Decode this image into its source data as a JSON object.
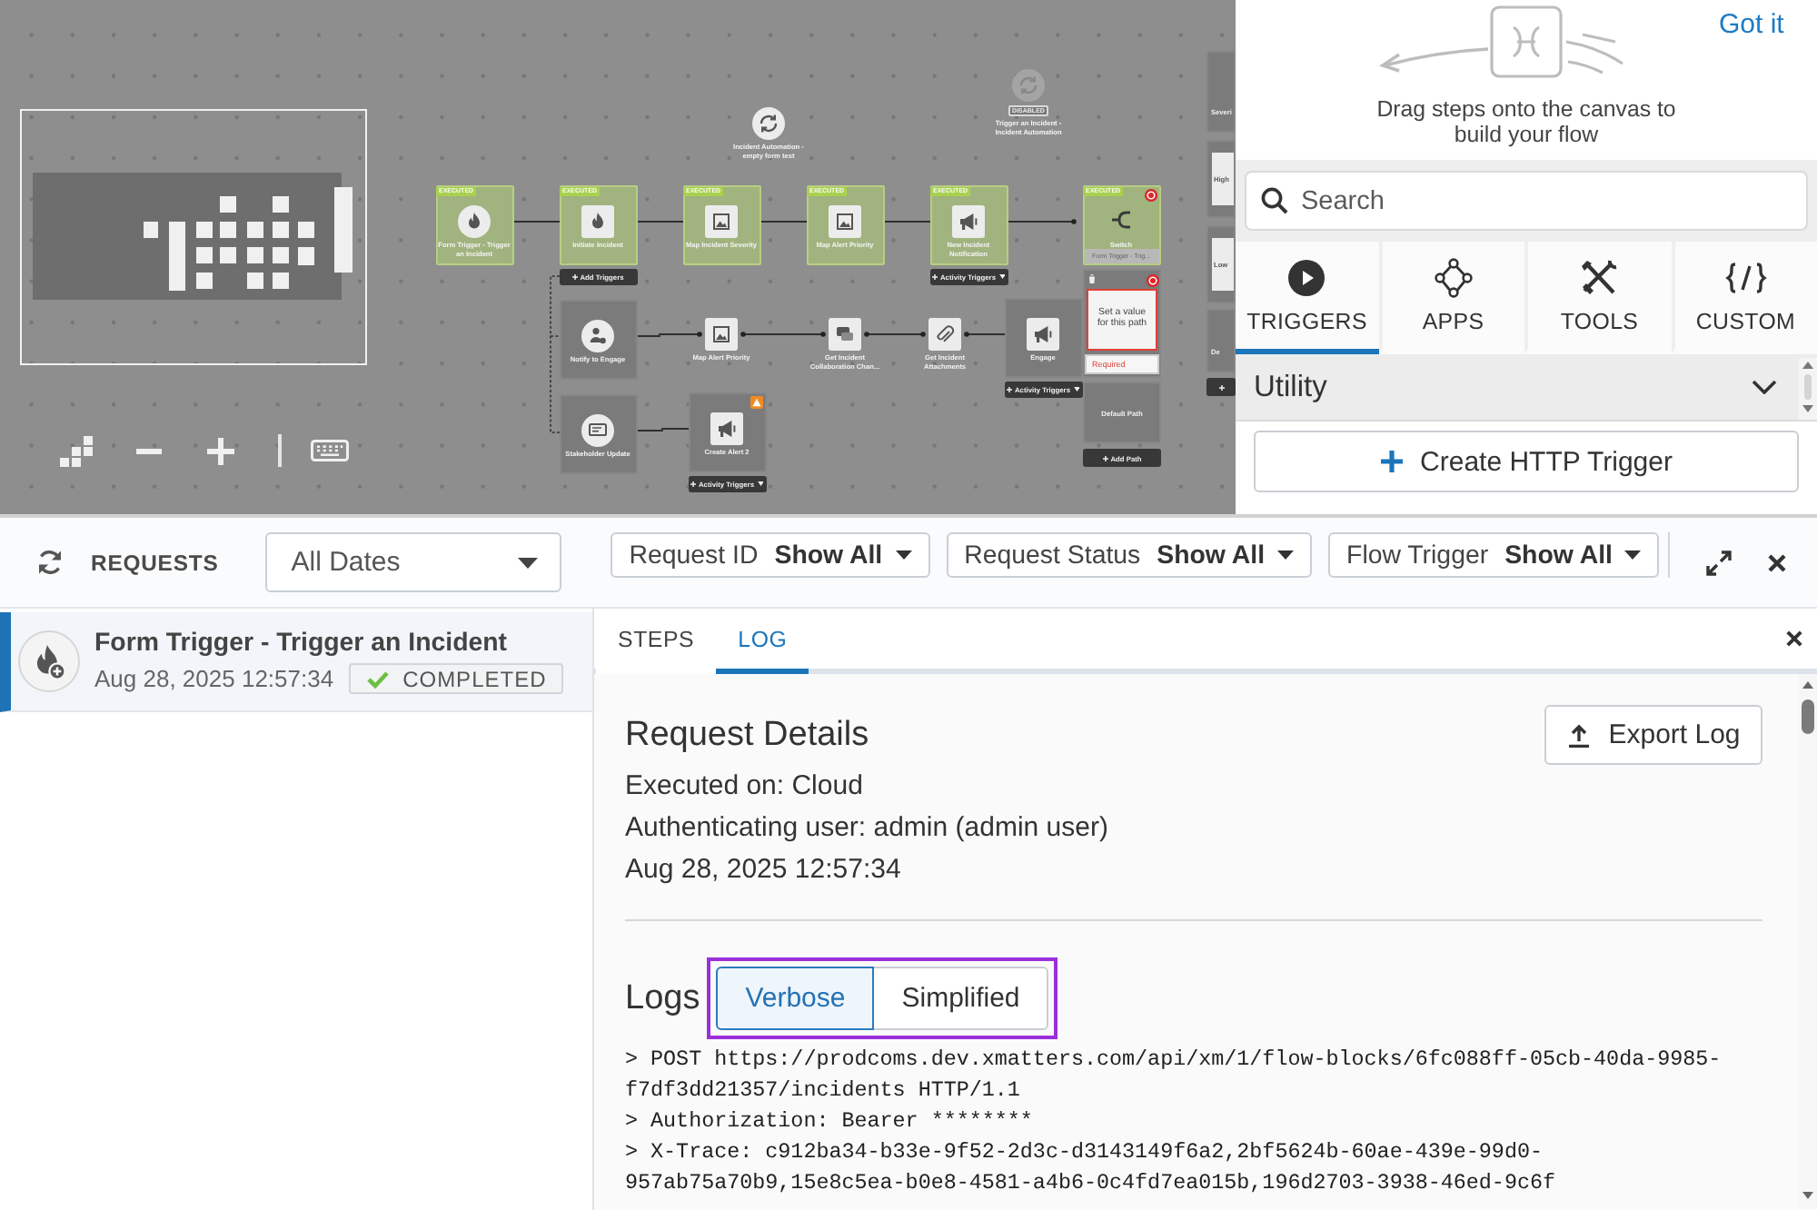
{
  "canvas": {
    "flows": [
      {
        "label": "Incident Automation - empty form test",
        "disabled": false
      },
      {
        "label": "Trigger an Incident - Incident Automation",
        "disabled": true,
        "badge": "DISABLED"
      }
    ],
    "steps": [
      {
        "kind": "trigger",
        "boxed": true,
        "executed": true,
        "error": false,
        "warning": false,
        "badge": "EXECUTED",
        "label": "Form Trigger - Trigger an Incident"
      },
      {
        "kind": "step",
        "boxed": true,
        "executed": true,
        "error": false,
        "warning": false,
        "badge": "EXECUTED",
        "label": "Initiate Incident",
        "button": {
          "kind": "add",
          "label": "Add Triggers"
        }
      },
      {
        "kind": "step",
        "boxed": true,
        "executed": true,
        "error": false,
        "warning": false,
        "badge": "EXECUTED",
        "label": "Map Incident Severity"
      },
      {
        "kind": "step",
        "boxed": true,
        "executed": true,
        "error": false,
        "warning": false,
        "badge": "EXECUTED",
        "label": "Map Alert Priority"
      },
      {
        "kind": "step",
        "boxed": true,
        "executed": true,
        "error": false,
        "warning": false,
        "badge": "EXECUTED",
        "label": "New Incident Notification",
        "button": {
          "kind": "menu",
          "label": "Activity Triggers"
        }
      },
      {
        "kind": "switch",
        "boxed": true,
        "executed": true,
        "error": true,
        "warning": false,
        "badge": "EXECUTED",
        "label": "Switch",
        "subtitle": "Form Trigger - Trig..."
      },
      {
        "kind": "trigger",
        "boxed": true,
        "executed": false,
        "error": false,
        "warning": false,
        "label": "Notify to Engage"
      },
      {
        "kind": "step",
        "boxed": false,
        "executed": false,
        "error": false,
        "warning": false,
        "label": "Map Alert Priority"
      },
      {
        "kind": "step",
        "boxed": false,
        "executed": false,
        "error": false,
        "warning": false,
        "label": "Get Incident Collaboration Chan..."
      },
      {
        "kind": "step",
        "boxed": false,
        "executed": false,
        "error": false,
        "warning": false,
        "label": "Get Incident Attachments"
      },
      {
        "kind": "step",
        "boxed": true,
        "executed": false,
        "error": false,
        "warning": false,
        "label": "Engage",
        "button": {
          "kind": "menu",
          "label": "Activity Triggers"
        }
      },
      {
        "kind": "trigger",
        "boxed": true,
        "executed": false,
        "error": false,
        "warning": false,
        "label": "Stakeholder Update"
      },
      {
        "kind": "step",
        "boxed": true,
        "executed": false,
        "error": false,
        "warning": true,
        "label": "Create Alert 2",
        "button": {
          "kind": "menu",
          "label": "Activity Triggers"
        }
      }
    ],
    "switch_paths": [
      {
        "kind": "condition",
        "placeholder": "Set a value for this path",
        "invalid": true,
        "error": "Required"
      },
      {
        "kind": "default",
        "label": "Default Path"
      }
    ],
    "add_path": "Add Path",
    "edge_column": [
      "Severi",
      "High",
      "Low",
      "De"
    ]
  },
  "palette": {
    "hint": "Drag steps onto the canvas to build your flow",
    "dismiss": "Got it",
    "search": {
      "placeholder": "Search"
    },
    "tabs": [
      {
        "label": "TRIGGERS",
        "selected": true
      },
      {
        "label": "APPS",
        "selected": false
      },
      {
        "label": "TOOLS",
        "selected": false
      },
      {
        "label": "CUSTOM",
        "selected": false
      }
    ],
    "section": "Utility",
    "create_button": "Create HTTP Trigger"
  },
  "requests_bar": {
    "title": "REQUESTS",
    "date_filter": "All Dates",
    "filters": [
      {
        "label": "Request ID",
        "value": "Show All"
      },
      {
        "label": "Request Status",
        "value": "Show All"
      },
      {
        "label": "Flow Trigger",
        "value": "Show All"
      }
    ]
  },
  "requests": [
    {
      "title": "Form Trigger - Trigger an Incident",
      "time": "Aug 28, 2025 12:57:34",
      "status": "COMPLETED",
      "selected": true
    }
  ],
  "detail": {
    "tabs": [
      {
        "label": "STEPS",
        "selected": false
      },
      {
        "label": "LOG",
        "selected": true
      }
    ],
    "heading": "Request Details",
    "export_button": "Export Log",
    "info": [
      "Executed on: Cloud",
      "Authenticating user: admin (admin user)",
      "Aug 28, 2025 12:57:34"
    ],
    "logs_heading": "Logs",
    "modes": [
      {
        "label": "Verbose",
        "selected": true
      },
      {
        "label": "Simplified",
        "selected": false
      }
    ],
    "modes_highlighted": true,
    "log_lines": [
      "> POST https://prodcoms.dev.xmatters.com/api/xm/1/flow-blocks/6fc088ff-05cb-40da-9985-",
      "f7df3dd21357/incidents HTTP/1.1",
      "> Authorization: Bearer ********",
      "> X-Trace: c912ba34-b33e-9f52-2d3c-d3143149f6a2,2bf5624b-60ae-439e-99d0-",
      "957ab75a70b9,15e8c5ea-b0e8-4581-a4b6-0c4fd7ea015b,196d2703-3938-46ed-9c6f"
    ]
  }
}
